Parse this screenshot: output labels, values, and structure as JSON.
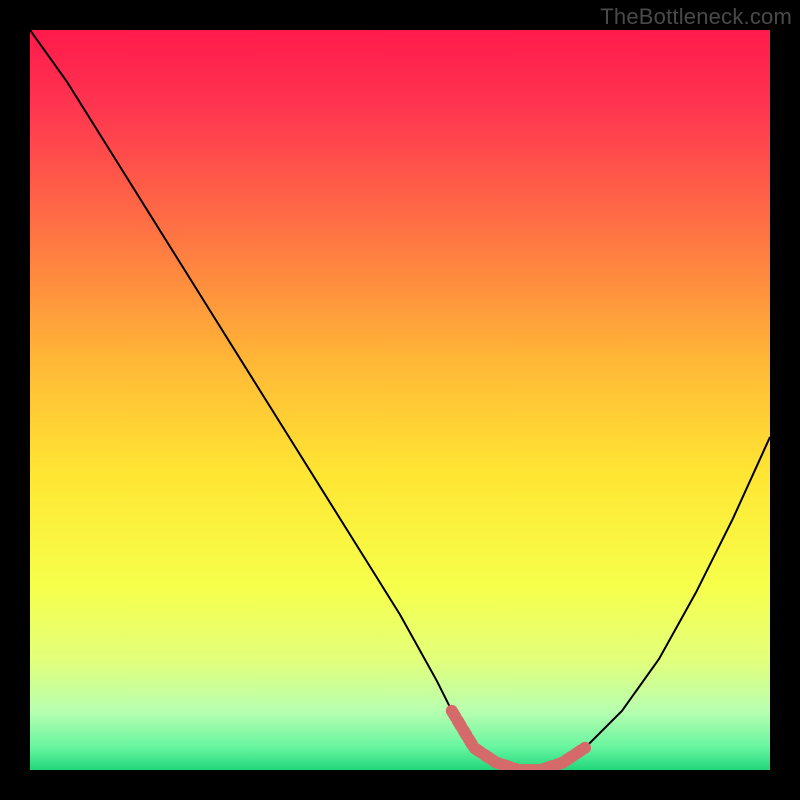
{
  "watermark": "TheBottleneck.com",
  "colors": {
    "background": "#000000",
    "curve": "#000000",
    "marker": "#d46a6a",
    "gradient_stops": [
      {
        "offset": 0.0,
        "color": "#ff1a4b"
      },
      {
        "offset": 0.1,
        "color": "#ff3450"
      },
      {
        "offset": 0.25,
        "color": "#ff6a45"
      },
      {
        "offset": 0.45,
        "color": "#ffb836"
      },
      {
        "offset": 0.6,
        "color": "#ffe633"
      },
      {
        "offset": 0.75,
        "color": "#f6ff4a"
      },
      {
        "offset": 0.85,
        "color": "#e3ff7a"
      },
      {
        "offset": 0.92,
        "color": "#b8ffb0"
      },
      {
        "offset": 0.97,
        "color": "#66f5a0"
      },
      {
        "offset": 1.0,
        "color": "#21d67a"
      }
    ]
  },
  "chart_data": {
    "type": "line",
    "title": "",
    "xlabel": "",
    "ylabel": "",
    "xlim": [
      0,
      100
    ],
    "ylim": [
      0,
      100
    ],
    "grid": false,
    "series": [
      {
        "name": "bottleneck-curve",
        "x": [
          0,
          5,
          10,
          15,
          20,
          25,
          30,
          35,
          40,
          45,
          50,
          55,
          57,
          60,
          63,
          66,
          69,
          72,
          75,
          80,
          85,
          90,
          95,
          100
        ],
        "y": [
          100,
          93,
          85,
          77,
          69,
          61,
          53,
          45,
          37,
          29,
          21,
          12,
          8,
          3,
          1,
          0,
          0,
          1,
          3,
          8,
          15,
          24,
          34,
          45
        ]
      }
    ],
    "markers": {
      "name": "highlight-segment",
      "x": [
        57,
        60,
        63,
        66,
        69,
        72,
        75
      ],
      "y": [
        8,
        3,
        1,
        0,
        0,
        1,
        3
      ]
    }
  }
}
